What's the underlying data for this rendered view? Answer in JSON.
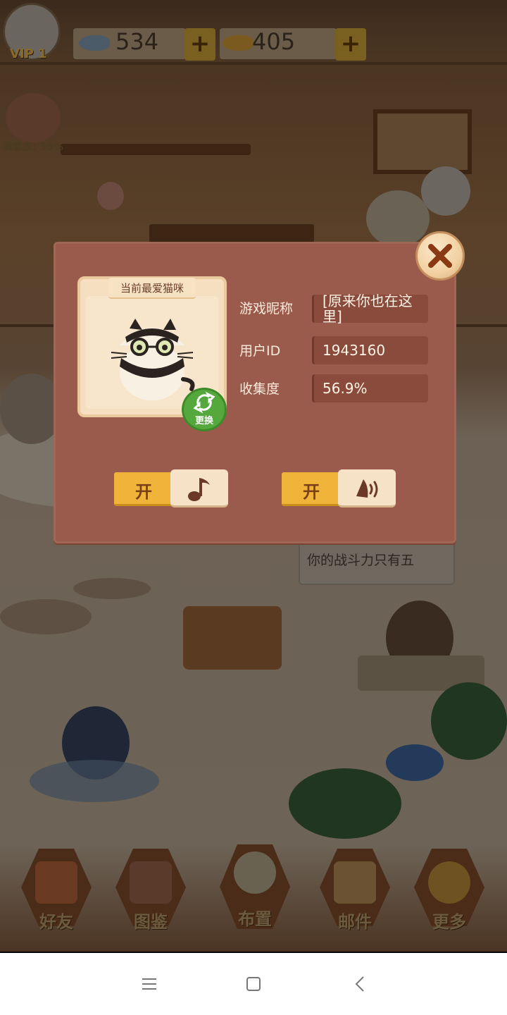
{
  "top_bar": {
    "vip_label": "VIP 1",
    "fish_count": "534",
    "gold_fish_count": "405",
    "satisfaction": "满意度: 55%"
  },
  "scene": {
    "speech_bubble": "你的战斗力只有五"
  },
  "dialog": {
    "favorite_cat_title": "当前最爱猫咪",
    "change_label": "更换",
    "nickname_label": "游戏昵称",
    "nickname_value": "[原来你也在这里]",
    "user_id_label": "用户ID",
    "user_id_value": "1943160",
    "collection_label": "收集度",
    "collection_value": "56.9%",
    "music_toggle_label": "开",
    "sound_toggle_label": "开"
  },
  "bottom_nav": {
    "items": [
      {
        "label": "好友"
      },
      {
        "label": "图鉴"
      },
      {
        "label": "布置"
      },
      {
        "label": "邮件"
      },
      {
        "label": "更多"
      }
    ]
  },
  "colors": {
    "dialog_bg": "#9a5a4c",
    "toggle_on": "#f0b43a",
    "change_button": "#55a83c"
  }
}
